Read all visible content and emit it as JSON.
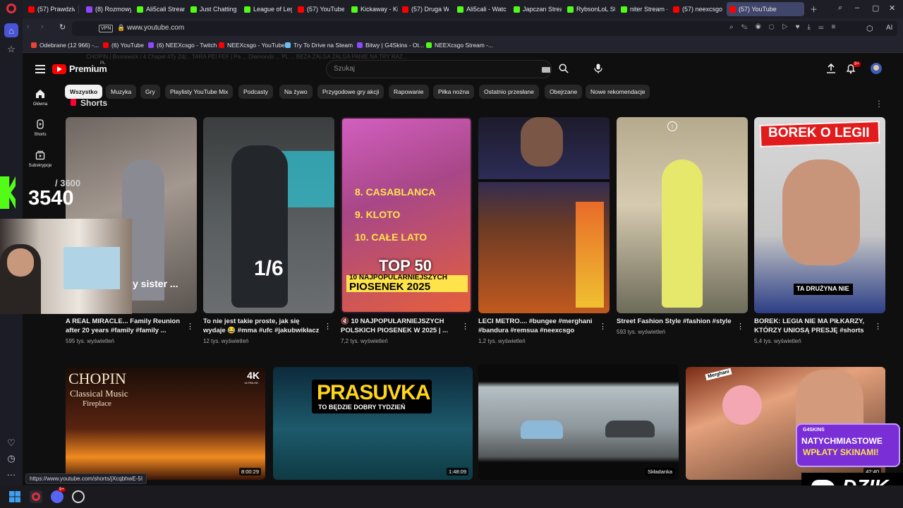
{
  "tabs": [
    {
      "label": "(57) Prawdziwy",
      "color": "#ff0000"
    },
    {
      "label": "(8) Rozmowy",
      "color": "#9147ff"
    },
    {
      "label": "Ali5cali Stream",
      "color": "#53fc18"
    },
    {
      "label": "Just Chatting S",
      "color": "#53fc18"
    },
    {
      "label": "League of Lege",
      "color": "#53fc18"
    },
    {
      "label": "(57) YouTube",
      "color": "#ff0000"
    },
    {
      "label": "Kickaway - Kic",
      "color": "#53fc18"
    },
    {
      "label": "(57) Druga W",
      "color": "#ff0000"
    },
    {
      "label": "Ali5cali - Watc",
      "color": "#53fc18"
    },
    {
      "label": "Japczan Stream",
      "color": "#53fc18"
    },
    {
      "label": "RybsonLoL Stre",
      "color": "#53fc18"
    },
    {
      "label": "niter Stream -",
      "color": "#53fc18"
    },
    {
      "label": "(57) neexcsgo",
      "color": "#ff0000"
    },
    {
      "label": "(57) YouTube",
      "color": "#ff0000"
    }
  ],
  "address": {
    "vpn": "VPN",
    "url": "www.youtube.com",
    "ai": "AI"
  },
  "bookmarks": [
    {
      "label": "Odebrane (12 966) -...",
      "color": "#ea4335"
    },
    {
      "label": "(6) YouTube",
      "color": "#ff0000"
    },
    {
      "label": "(6) NEEXcsgo - Twitch",
      "color": "#9147ff"
    },
    {
      "label": "NEEXcsgo - YouTube",
      "color": "#ff0000"
    },
    {
      "label": "Try To Drive na Steam",
      "color": "#66c0f4"
    },
    {
      "label": "Bitwy | G4Skins - Ot...",
      "color": "#8a4cff"
    },
    {
      "label": "NEEXcsgo Stream -...",
      "color": "#53fc18"
    }
  ],
  "ghost_text": "CHOPIN | Brunswick / 4 Chapel 4Ty Zdj...      TARA PEI FEF | Pa ...    Diamonds ...     PL ...     BEZA ZALGA ZALGA PANIE NA TRY RAZ...",
  "youtube": {
    "brand": "Premium",
    "region": "PL",
    "search_placeholder": "Szukaj",
    "notif_badge": "9+",
    "nav": [
      {
        "label": "Główna"
      },
      {
        "label": "Shorts"
      },
      {
        "label": "Subskrypcje"
      }
    ],
    "chips": [
      "Wszystko",
      "Muzyka",
      "Gry",
      "Playlisty YouTube Mix",
      "Podcasty",
      "Na żywo",
      "Przygodowe gry akcji",
      "Rapowanie",
      "Piłka nożna",
      "Ostatnio przesłane",
      "Obejrzane",
      "Nowe rekomendacje"
    ],
    "shorts_heading": "Shorts",
    "shorts": [
      {
        "title": "A REAL MIRACLE... Family Reunion after 20 years #family #family ...",
        "views": "595 tys. wyświetleń",
        "caption": "y sister ..."
      },
      {
        "title": "To nie jest takie proste, jak się wydaje 😂 #mma #ufc #jakubwikłacz",
        "views": "12 tys. wyświetleń",
        "caption": "1/6"
      },
      {
        "title": "🔇 10 NAJPOPULARNIEJSZYCH POLSKICH PIOSENEK W 2025 | ...",
        "views": "7,2 tys. wyświetleń",
        "caption": "TOP 50",
        "list": [
          "8. CASABLANCA",
          "9. KLOTO",
          "10. CAŁE LATO"
        ],
        "sub": "10 NAJPOPULARNIEJSZYCH",
        "sub2": "PIOSENEK 2025"
      },
      {
        "title": "LECI METRO.... #bungee #merghani #bandura #remsua #neexcsgo",
        "views": "1,2 tys. wyświetleń",
        "caption": ""
      },
      {
        "title": "Street Fashion Style #fashion #style",
        "views": "593 tys. wyświetleń",
        "caption": ""
      },
      {
        "title": "BOREK: LEGIA NIE MA PIŁKARZY, KTÓRZY UNIOSĄ PRESJĘ #shorts",
        "views": "5,4 tys. wyświetleń",
        "caption": "TA DRUŻYNA NIE",
        "banner": "BOREK O LEGII"
      }
    ],
    "videos": [
      {
        "duration": "8:00:29",
        "t1": "CHOPIN",
        "t2": "Classical Music",
        "t3": "Fireplace",
        "badge": "4K",
        "badge_sub": "ULTRA HD"
      },
      {
        "duration": "1:48:09",
        "t1": "PRASUVKA",
        "t2": "TO BĘDZIE DOBRY TYDZIEŃ"
      },
      {
        "duration": "Składanka"
      },
      {
        "duration": "42:40",
        "tag": "Merghani"
      }
    ]
  },
  "overlays": {
    "counter_total": "/ 3600",
    "counter_value": "3540",
    "promo_brand": "G4SKINS",
    "promo_l1": "NATYCHMIASTOWE",
    "promo_l2": "WPŁATY SKINAMI!",
    "dzik": "DZIK"
  },
  "status_url": "https://www.youtube.com/shorts/jXcqbhwE-5I",
  "taskbar": {
    "discord_badge": "9+"
  }
}
